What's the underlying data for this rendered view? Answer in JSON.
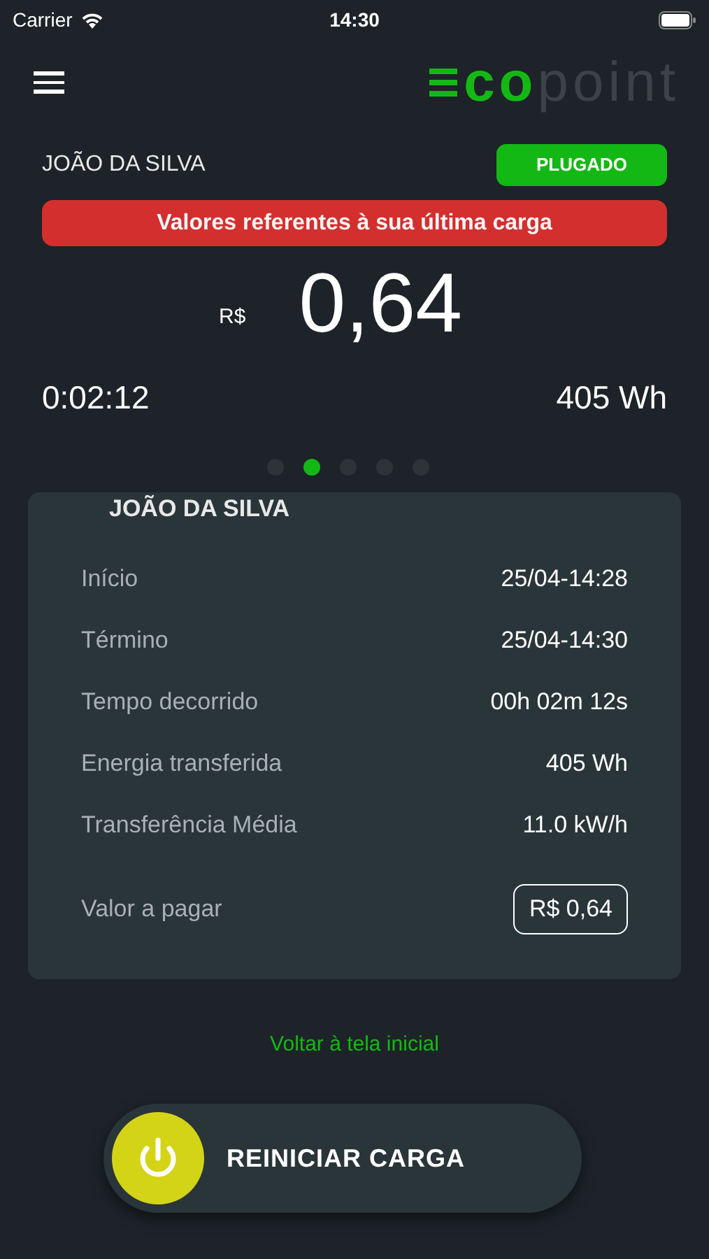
{
  "status_bar": {
    "carrier": "Carrier",
    "time": "14:30"
  },
  "logo": {
    "accent": "co",
    "rest": "point"
  },
  "user_name": "JOÃO DA SILVA",
  "status_badge": "PLUGADO",
  "banner": "Valores referentes à sua última carga",
  "amount": {
    "currency": "R$",
    "value": "0,64"
  },
  "elapsed": "0:02:12",
  "energy": "405 Wh",
  "pages": [
    {
      "selected": false
    },
    {
      "selected": true
    },
    {
      "selected": false
    },
    {
      "selected": false
    },
    {
      "selected": false
    }
  ],
  "card": {
    "title": "JOÃO DA SILVA",
    "rows": [
      {
        "label": "Início",
        "value": "25/04-14:28"
      },
      {
        "label": "Término",
        "value": "25/04-14:30"
      },
      {
        "label": "Tempo decorrido",
        "value": "00h 02m 12s"
      },
      {
        "label": "Energia transferida",
        "value": "405 Wh"
      },
      {
        "label": "Transferência Média",
        "value": "11.0 kW/h"
      }
    ],
    "total": {
      "label": "Valor a pagar",
      "value": "R$ 0,64"
    }
  },
  "back_link": "Voltar à tela inicial",
  "action_button": "REINICIAR CARGA"
}
